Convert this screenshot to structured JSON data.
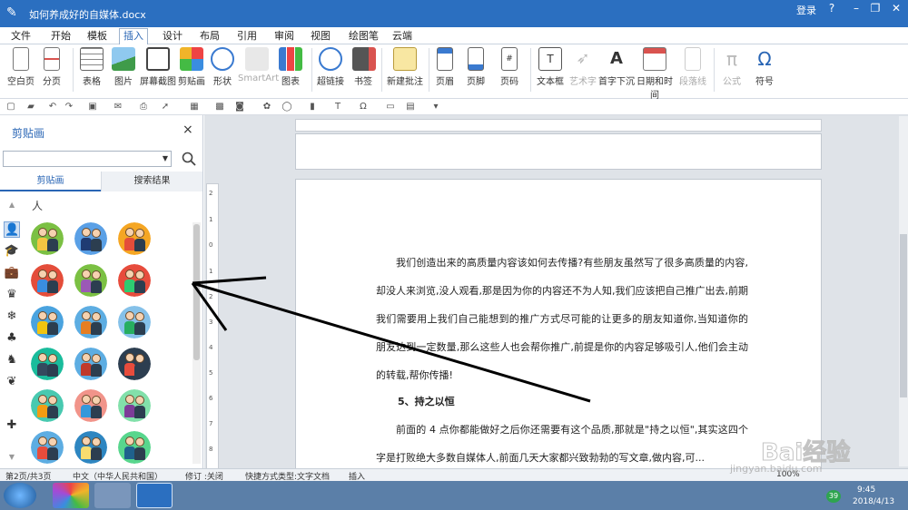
{
  "titlebar": {
    "document_title": "如何养成好的自媒体.docx",
    "login_label": "登录",
    "help_glyph": "?",
    "minimize_glyph": "–",
    "restore_glyph": "❐",
    "close_glyph": "✕"
  },
  "ribbon_tabs": [
    {
      "label": "文件"
    },
    {
      "label": "开始"
    },
    {
      "label": "模板"
    },
    {
      "label": "插入",
      "active": true
    },
    {
      "label": "设计"
    },
    {
      "label": "布局"
    },
    {
      "label": "引用"
    },
    {
      "label": "审阅"
    },
    {
      "label": "视图"
    },
    {
      "label": "绘图笔"
    },
    {
      "label": "云端"
    }
  ],
  "ribbon_buttons": [
    {
      "label": "空白页",
      "icon": "blank-page-icon"
    },
    {
      "label": "分页",
      "icon": "page-break-icon"
    },
    {
      "label": "表格",
      "icon": "table-icon"
    },
    {
      "label": "图片",
      "icon": "picture-icon"
    },
    {
      "label": "屏幕截图",
      "icon": "screenshot-icon"
    },
    {
      "label": "剪贴画",
      "icon": "clipart-icon"
    },
    {
      "label": "形状",
      "icon": "shapes-icon"
    },
    {
      "label": "SmartArt",
      "icon": "smartart-icon",
      "disabled": true
    },
    {
      "label": "图表",
      "icon": "chart-icon"
    },
    {
      "label": "超链接",
      "icon": "hyperlink-icon"
    },
    {
      "label": "书签",
      "icon": "bookmark-icon"
    },
    {
      "label": "新建批注",
      "icon": "new-comment-icon"
    },
    {
      "label": "页眉",
      "icon": "header-icon"
    },
    {
      "label": "页脚",
      "icon": "footer-icon"
    },
    {
      "label": "页码",
      "icon": "page-number-icon"
    },
    {
      "label": "文本框",
      "icon": "textbox-icon"
    },
    {
      "label": "艺术字",
      "icon": "wordart-icon",
      "disabled": true
    },
    {
      "label": "首字下沉",
      "icon": "drop-cap-icon"
    },
    {
      "label": "日期和时间",
      "icon": "date-time-icon"
    },
    {
      "label": "段落线",
      "icon": "paragraph-line-icon",
      "disabled": true
    },
    {
      "label": "公式",
      "icon": "equation-icon",
      "disabled": true
    },
    {
      "label": "符号",
      "icon": "symbol-icon"
    }
  ],
  "clipart_pane": {
    "title": "剪贴画",
    "close_glyph": "×",
    "search_value": "",
    "tab_clipart": "剪贴画",
    "tab_results": "搜索结果",
    "category_label": "人",
    "categories": [
      "person-icon",
      "graduation-cap-icon",
      "briefcase-icon",
      "crown-icon",
      "snowflake-icon",
      "clover-icon",
      "animal-icon",
      "heart-hand-icon",
      "plus-icon"
    ]
  },
  "document": {
    "paragraph1": "我们创造出来的高质量内容该如何去传播?有些朋友虽然写了很多高质量的内容,却没人来浏览,没人观看,那是因为你的内容还不为人知,我们应该把自己推广出去,前期我们需要用上我们自己能想到的推广方式尽可能的让更多的朋友知道你,当知道你的朋友达到一定数量,那么这些人也会帮你推广,前提是你的内容足够吸引人,他们会主动的转载,帮你传播!",
    "heading": "5、持之以恒",
    "paragraph2": "前面的 4 点你都能做好之后你还需要有这个品质,那就是\"持之以恒\",其实这四个字是打败绝大多数自媒体人,前面几天大家都兴致勃勃的写文章,做内容,可..."
  },
  "ruler_numbers": [
    "2",
    "1",
    "0",
    "1",
    "2",
    "3",
    "4",
    "5",
    "6",
    "7",
    "8",
    "9"
  ],
  "statusbar": {
    "page": "第2页/共3页",
    "language": "中文（中华人民共和国）",
    "revision": "修订 :关闭",
    "shortcut": "快捷方式类型:文字文档",
    "insert_mode": "插入",
    "zoom": "100%"
  },
  "taskbar": {
    "time": "9:45",
    "date": "2018/4/13",
    "badge": "39"
  },
  "watermark": {
    "text": "Bai经验",
    "url": "jingyan.baidu.com"
  },
  "colors": {
    "titlebar": "#2b6fc0",
    "accent": "#2a66b5",
    "taskbar": "#5b7fa8"
  }
}
